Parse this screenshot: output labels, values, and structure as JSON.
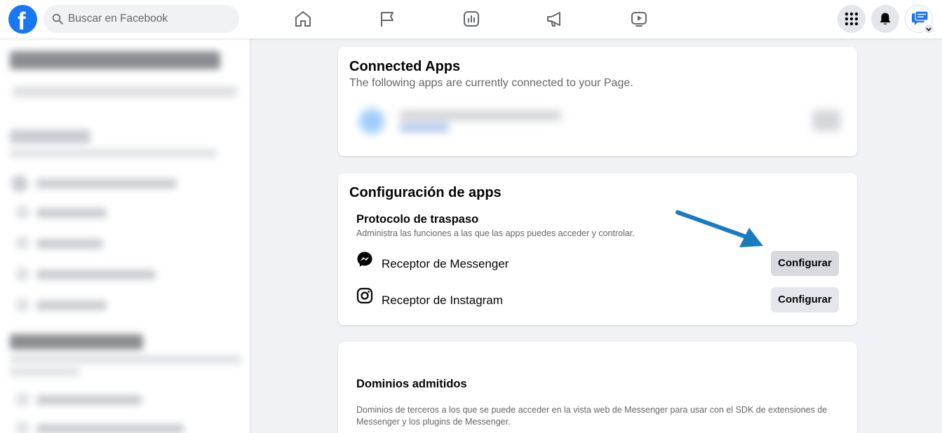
{
  "topbar": {
    "logo_letter": "f",
    "search_placeholder": "Buscar en Facebook",
    "nav_icons": [
      "home-icon",
      "flag-icon",
      "insights-icon",
      "megaphone-icon",
      "video-icon"
    ],
    "right_icons": [
      "menu-grid-icon",
      "notifications-bell-icon",
      "messenger-chat-icon"
    ]
  },
  "connected_apps": {
    "title": "Connected Apps",
    "subtitle": "The following apps are currently connected to your Page."
  },
  "app_config": {
    "title": "Configuración de apps",
    "protocol_title": "Protocolo de traspaso",
    "protocol_desc": "Administra las funciones a las que las apps puedes acceder y controlar.",
    "rows": [
      {
        "icon": "messenger-icon",
        "label": "Receptor de Messenger",
        "button": "Configurar"
      },
      {
        "icon": "instagram-icon",
        "label": "Receptor de Instagram",
        "button": "Configurar"
      }
    ]
  },
  "domains": {
    "title": "Dominios admitidos",
    "desc": "Dominios de terceros a los que se puede acceder en la vista web de Messenger para usar con el SDK de extensiones de Messenger y los plugins de Messenger."
  },
  "colors": {
    "brand": "#1877f2",
    "annotation_arrow": "#1a7bbf",
    "button_bg": "#e4e6eb",
    "page_bg": "#f0f2f5"
  }
}
